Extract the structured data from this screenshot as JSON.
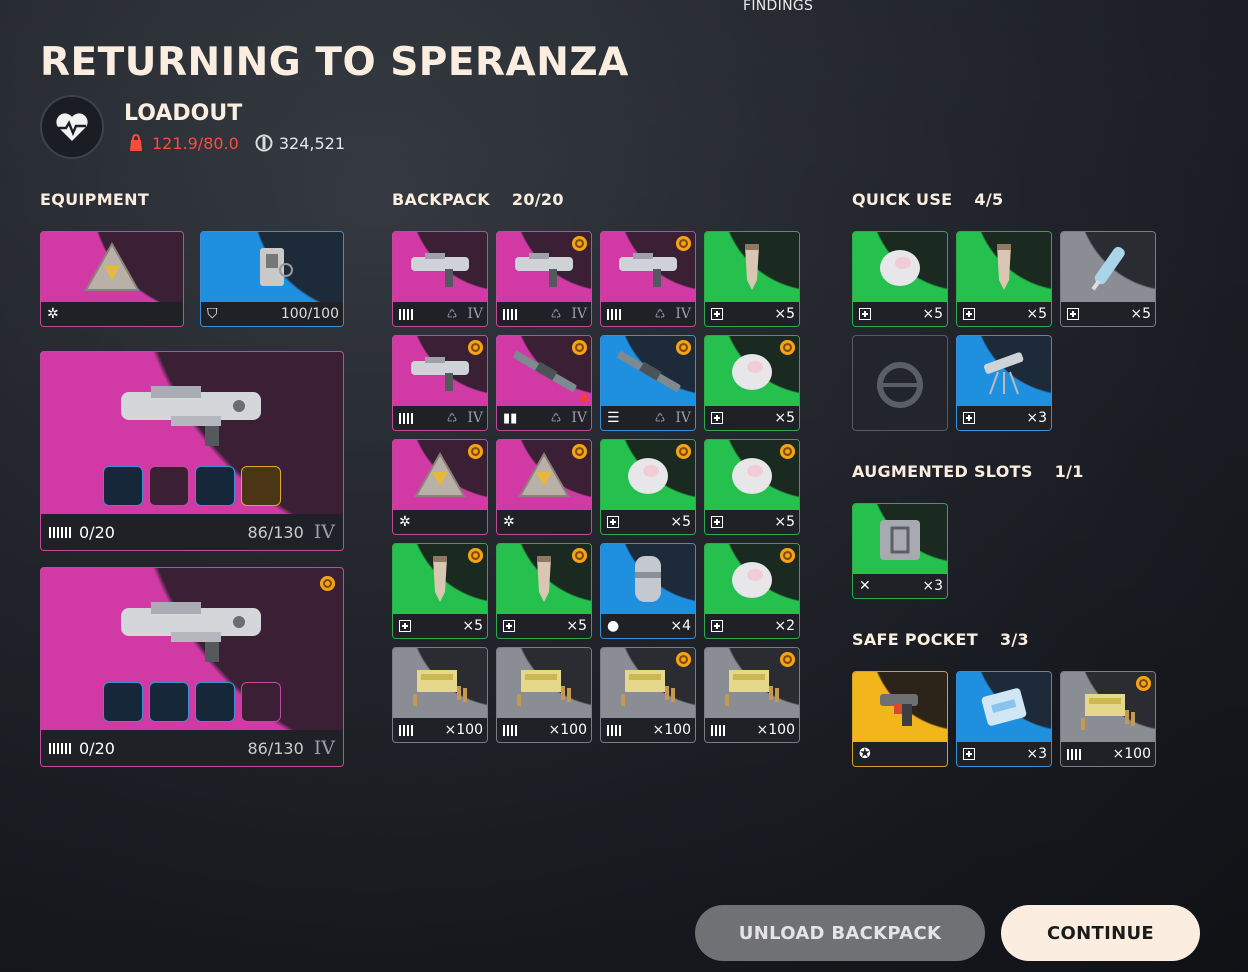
{
  "header": {
    "findings": "FINDINGS",
    "title": "RETURNING TO SPERANZA"
  },
  "loadout": {
    "label": "LOADOUT",
    "weight": "121.9/80.0",
    "coins": "324,521"
  },
  "sections": {
    "equipment": "EQUIPMENT",
    "backpack": "BACKPACK",
    "backpack_count": "20/20",
    "quick_use": "QUICK USE",
    "quick_use_count": "4/5",
    "augmented": "AUGMENTED SLOTS",
    "augmented_count": "1/1",
    "safe_pocket": "SAFE POCKET",
    "safe_pocket_count": "3/3"
  },
  "equipment": {
    "augment": {
      "rarity": "pink",
      "icon": "augment-icon"
    },
    "shield": {
      "rarity": "blue",
      "value": "100/100"
    },
    "weapon1": {
      "ammo": "0/20",
      "durability": "86/130",
      "tier": "IV"
    },
    "weapon2": {
      "ammo": "0/20",
      "durability": "86/130",
      "tier": "IV"
    }
  },
  "backpack": [
    {
      "rarity": "pink",
      "bl": "ammo",
      "br": "IV",
      "coin": false,
      "art": "gun"
    },
    {
      "rarity": "pink",
      "bl": "ammo",
      "br": "IV",
      "coin": true,
      "art": "gun"
    },
    {
      "rarity": "pink",
      "bl": "ammo",
      "br": "IV",
      "coin": true,
      "art": "gun"
    },
    {
      "rarity": "green",
      "bl": "plus",
      "br": "×5",
      "coin": false,
      "art": "vial"
    },
    {
      "rarity": "pink",
      "bl": "ammo",
      "br": "IV",
      "coin": true,
      "art": "gun"
    },
    {
      "rarity": "pink",
      "bl": "mag",
      "br": "IV",
      "coin": true,
      "art": "rifle"
    },
    {
      "rarity": "blue",
      "bl": "list",
      "br": "IV",
      "coin": true,
      "art": "rifle"
    },
    {
      "rarity": "green",
      "bl": "plus",
      "br": "×5",
      "coin": true,
      "art": "bandage"
    },
    {
      "rarity": "pink",
      "bl": "aug",
      "br": "",
      "coin": true,
      "art": "aug"
    },
    {
      "rarity": "pink",
      "bl": "aug",
      "br": "",
      "coin": true,
      "art": "aug"
    },
    {
      "rarity": "green",
      "bl": "plus",
      "br": "×5",
      "coin": true,
      "art": "bandage"
    },
    {
      "rarity": "green",
      "bl": "plus",
      "br": "×5",
      "coin": true,
      "art": "bandage"
    },
    {
      "rarity": "green",
      "bl": "plus",
      "br": "×5",
      "coin": true,
      "art": "vial"
    },
    {
      "rarity": "green",
      "bl": "plus",
      "br": "×5",
      "coin": true,
      "art": "vial"
    },
    {
      "rarity": "blue",
      "bl": "grenade",
      "br": "×4",
      "coin": false,
      "art": "canister"
    },
    {
      "rarity": "green",
      "bl": "plus",
      "br": "×2",
      "coin": true,
      "art": "bandage"
    },
    {
      "rarity": "gray",
      "bl": "ammo",
      "br": "×100",
      "coin": false,
      "art": "ammo"
    },
    {
      "rarity": "gray",
      "bl": "ammo",
      "br": "×100",
      "coin": false,
      "art": "ammo"
    },
    {
      "rarity": "gray",
      "bl": "ammo",
      "br": "×100",
      "coin": true,
      "art": "ammo"
    },
    {
      "rarity": "gray",
      "bl": "ammo",
      "br": "×100",
      "coin": true,
      "art": "ammo"
    }
  ],
  "quick_use": [
    {
      "rarity": "green",
      "br": "×5",
      "art": "bandage"
    },
    {
      "rarity": "green",
      "br": "×5",
      "art": "vial"
    },
    {
      "rarity": "gray",
      "br": "×5",
      "art": "syringe"
    },
    {
      "rarity": "empty",
      "br": "",
      "art": "empty"
    },
    {
      "rarity": "blue",
      "br": "×3",
      "art": "turret"
    }
  ],
  "augmented": [
    {
      "rarity": "green",
      "br": "×3",
      "art": "crate"
    }
  ],
  "safe_pocket": [
    {
      "rarity": "gold",
      "br": "",
      "art": "pistol"
    },
    {
      "rarity": "blue",
      "br": "×3",
      "art": "bag"
    },
    {
      "rarity": "gray",
      "br": "×100",
      "art": "ammo",
      "coin": true
    }
  ],
  "buttons": {
    "unload": "UNLOAD BACKPACK",
    "continue": "CONTINUE"
  }
}
